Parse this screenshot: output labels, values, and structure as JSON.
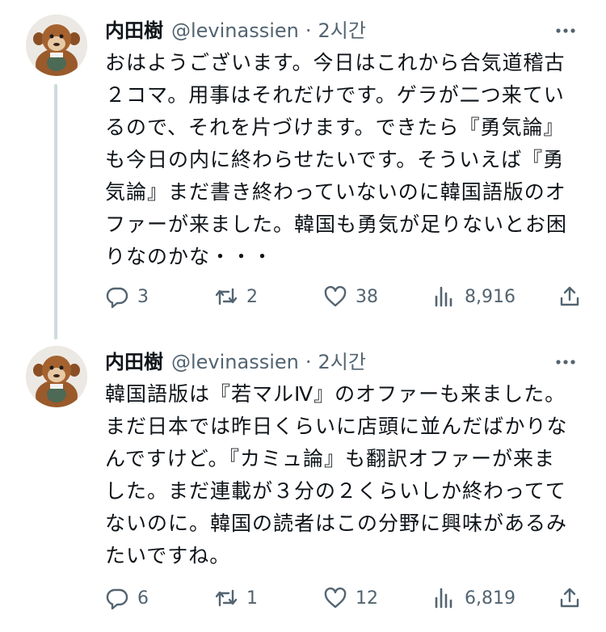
{
  "tweets": [
    {
      "author_name": "内田樹",
      "handle": "@levinassien",
      "separator": "·",
      "time": "2시간",
      "more_icon": "more-dots-icon",
      "text": "おはようございます。今日はこれから合気道稽古\n２コマ。用事はそれだけです。ゲラが二つ来てい\nるので、それを片づけます。できたら『勇気論』\nも今日の内に終わらせたいです。そういえば『勇\n気論』まだ書き終わっていないのに韓国語版のオ\nファーが来ました。韓国も勇気が足りないとお困\nりなのかな・・・",
      "replies": "3",
      "retweets": "2",
      "likes": "38",
      "views": "8,916"
    },
    {
      "author_name": "内田樹",
      "handle": "@levinassien",
      "separator": "·",
      "time": "2시간",
      "more_icon": "more-dots-icon",
      "text": "韓国語版は『若マルⅣ』のオファーも来ました。\nまだ日本では昨日くらいに店頭に並んだばかりな\nんですけど。『カミュ論』も翻訳オファーが来ま\nした。まだ連載が３分の２くらいしか終わってて\nないのに。韓国の読者はこの分野に興味があるみ\nたいですね。",
      "replies": "6",
      "retweets": "1",
      "likes": "12",
      "views": "6,819"
    }
  ],
  "icons": {
    "reply": "reply-bubble-icon",
    "retweet": "retweet-arrows-icon",
    "like": "heart-icon",
    "views": "views-bars-icon",
    "share": "share-upload-icon"
  },
  "colors": {
    "text": "#0f1419",
    "secondary": "#536471",
    "thread_line": "#cfd9de"
  }
}
